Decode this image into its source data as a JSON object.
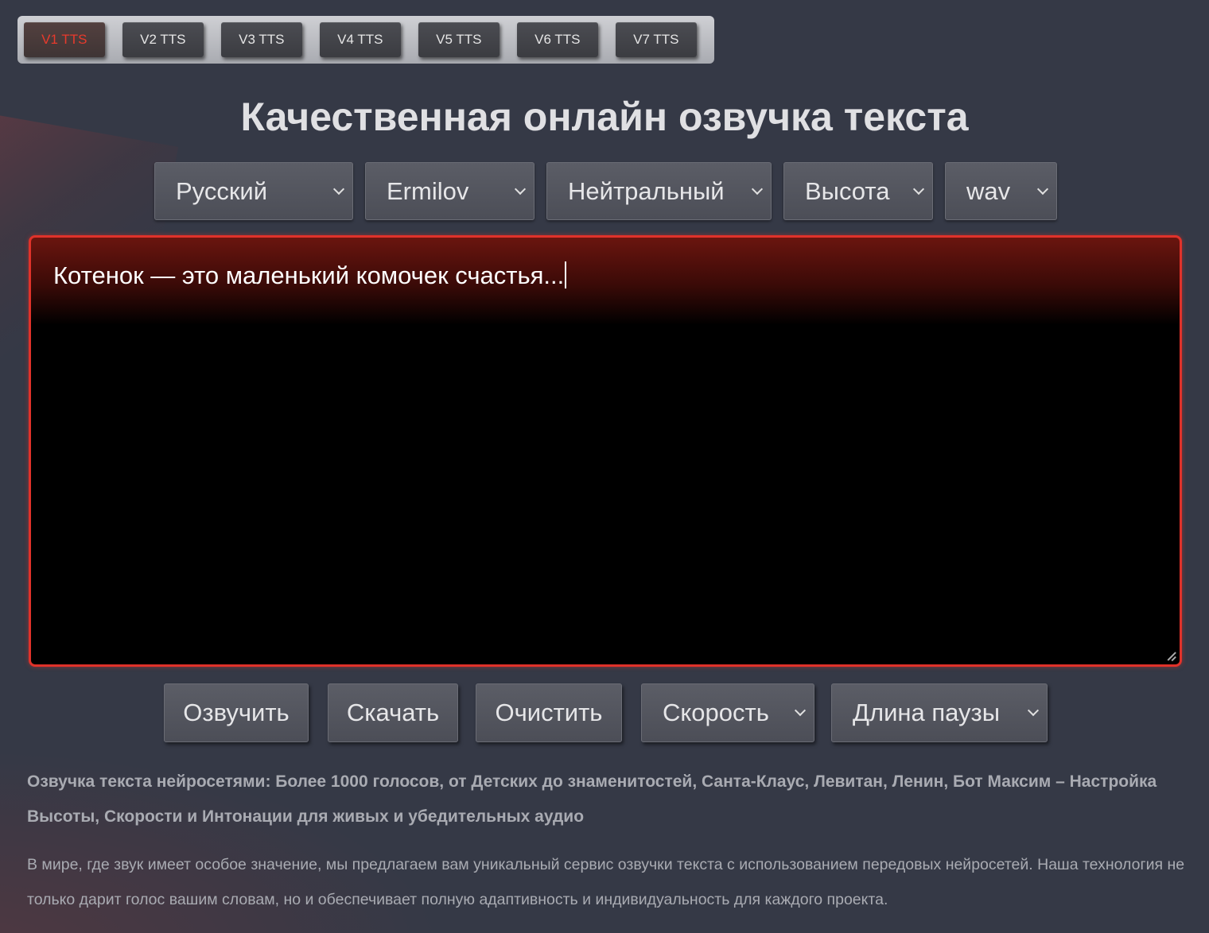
{
  "tabs": [
    {
      "label": "V1 TTS",
      "active": true
    },
    {
      "label": "V2 TTS"
    },
    {
      "label": "V3 TTS"
    },
    {
      "label": "V4 TTS"
    },
    {
      "label": "V5 TTS"
    },
    {
      "label": "V6 TTS"
    },
    {
      "label": "V7 TTS"
    }
  ],
  "title": "Качественная онлайн озвучка текста",
  "selects": {
    "language": "Русский",
    "voice": "Ermilov",
    "emotion": "Нейтральный",
    "pitch": "Высота",
    "format": "wav"
  },
  "text_input": {
    "value": "Котенок — это маленький комочек счастья..."
  },
  "actions": {
    "speak": "Озвучить",
    "download": "Скачать",
    "clear": "Очистить",
    "speed": "Скорость",
    "pause": "Длина паузы"
  },
  "description": {
    "headline": "Озвучка текста нейросетями: Более 1000 голосов, от Детских до знаменитостей, Санта-Клаус, Левитан, Ленин, Бот Максим – Настройка Высоты, Скорости и Интонации для живых и убедительных аудио",
    "body": "В мире, где звук имеет особое значение, мы предлагаем вам уникальный сервис озвучки текста с использованием передовых нейросетей. Наша технология не только дарит голос вашим словам, но и обеспечивает полную адаптивность и индивидуальность для каждого проекта."
  },
  "colors": {
    "accent": "#e0322a",
    "background": "#353946"
  }
}
